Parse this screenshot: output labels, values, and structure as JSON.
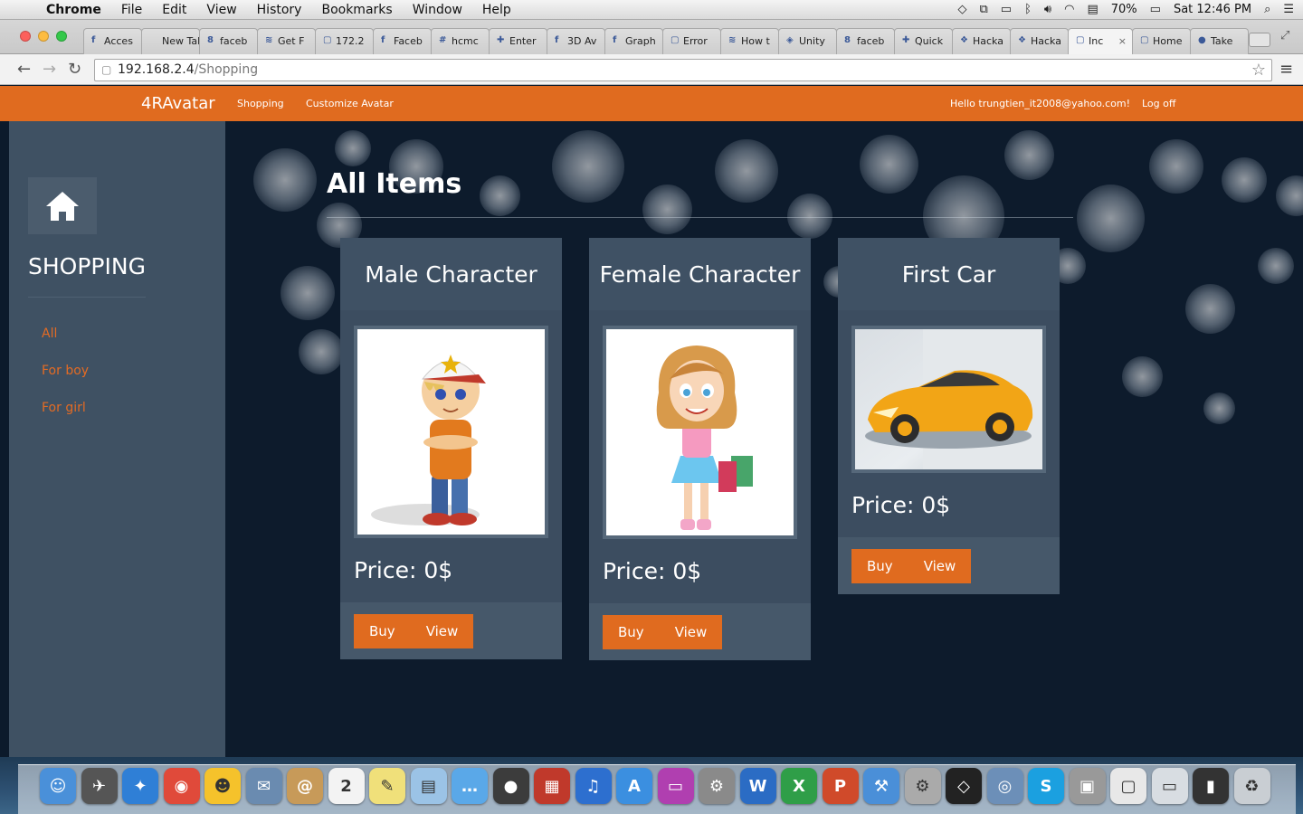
{
  "menubar": {
    "app": "Chrome",
    "items": [
      "File",
      "Edit",
      "View",
      "History",
      "Bookmarks",
      "Window",
      "Help"
    ],
    "battery": "70%",
    "clock": "Sat 12:46 PM"
  },
  "browser": {
    "tabs": [
      {
        "favicon": "f",
        "label": "Acces"
      },
      {
        "favicon": "",
        "label": "New Tab"
      },
      {
        "favicon": "8",
        "label": "faceb"
      },
      {
        "favicon": "≋",
        "label": "Get F"
      },
      {
        "favicon": "▢",
        "label": "172.2"
      },
      {
        "favicon": "f",
        "label": "Faceb"
      },
      {
        "favicon": "#",
        "label": "hcmc"
      },
      {
        "favicon": "✚",
        "label": "Enter"
      },
      {
        "favicon": "f",
        "label": "3D Av"
      },
      {
        "favicon": "f",
        "label": "Graph"
      },
      {
        "favicon": "▢",
        "label": "Error"
      },
      {
        "favicon": "≋",
        "label": "How t"
      },
      {
        "favicon": "◈",
        "label": "Unity"
      },
      {
        "favicon": "8",
        "label": "faceb"
      },
      {
        "favicon": "✚",
        "label": "Quick"
      },
      {
        "favicon": "❖",
        "label": "Hacka"
      },
      {
        "favicon": "❖",
        "label": "Hacka"
      },
      {
        "favicon": "▢",
        "label": "Inc"
      },
      {
        "favicon": "▢",
        "label": "Home"
      },
      {
        "favicon": "●",
        "label": "Take"
      }
    ],
    "url_host": "192.168.2.4",
    "url_path": "/Shopping"
  },
  "site": {
    "brand": "4RAvatar",
    "nav": [
      "Shopping",
      "Customize Avatar"
    ],
    "greeting": "Hello trungtien_it2008@yahoo.com!",
    "logoff": "Log off"
  },
  "sidebar": {
    "title": "SHOPPING",
    "links": [
      "All",
      "For boy",
      "For girl"
    ]
  },
  "main": {
    "title": "All Items",
    "items": [
      {
        "name": "Male Character",
        "price": "Price: 0$",
        "buy": "Buy",
        "view": "View"
      },
      {
        "name": "Female Character",
        "price": "Price: 0$",
        "buy": "Buy",
        "view": "View"
      },
      {
        "name": "First Car",
        "price": "Price: 0$",
        "buy": "Buy",
        "view": "View"
      }
    ]
  },
  "colors": {
    "accent": "#e06b1f",
    "sidebar": "#3f5163",
    "card": "#3c4d60"
  }
}
